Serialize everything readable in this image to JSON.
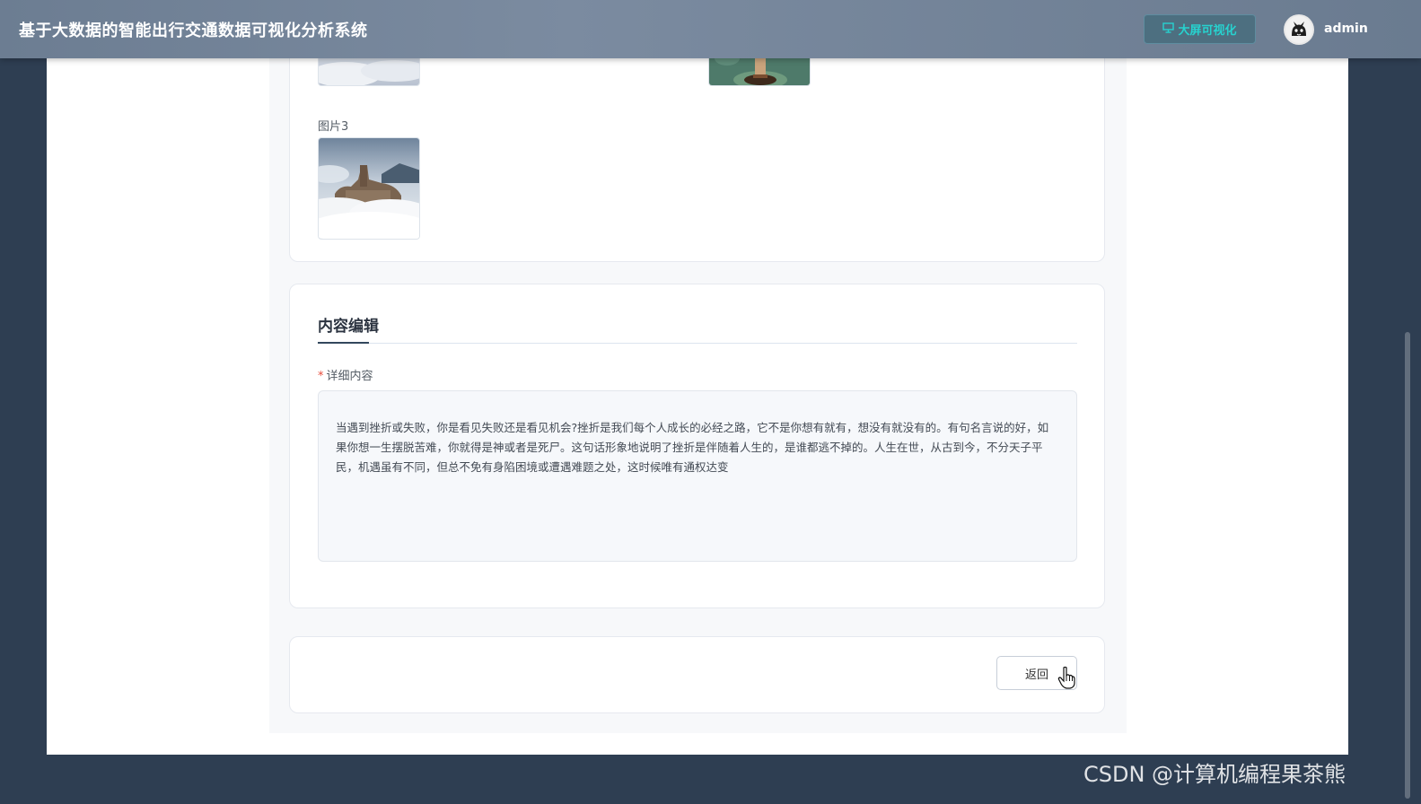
{
  "header": {
    "app_title": "基于大数据的智能出行交通数据可视化分析系统",
    "bigscreen_label": "大屏可视化",
    "username": "admin"
  },
  "images": {
    "image3_label": "图片3"
  },
  "editor": {
    "section_title": "内容编辑",
    "required_mark": "*",
    "detail_label": "详细内容",
    "detail_content": "当遇到挫折或失败，你是看见失败还是看见机会?挫折是我们每个人成长的必经之路，它不是你想有就有，想没有就没有的。有句名言说的好，如果你想一生摆脱苦难，你就得是神或者是死尸。这句话形象地说明了挫折是伴随着人生的，是谁都逃不掉的。人生在世，从古到今，不分天子平民，机遇虽有不同，但总不免有身陷困境或遭遇难题之处，这时候唯有通权达变"
  },
  "actions": {
    "back_label": "返回"
  },
  "watermark": "CSDN @计算机编程果茶熊",
  "colors": {
    "background": "#2e3e52",
    "accent": "#27d2cf",
    "required": "#e74c3c"
  }
}
